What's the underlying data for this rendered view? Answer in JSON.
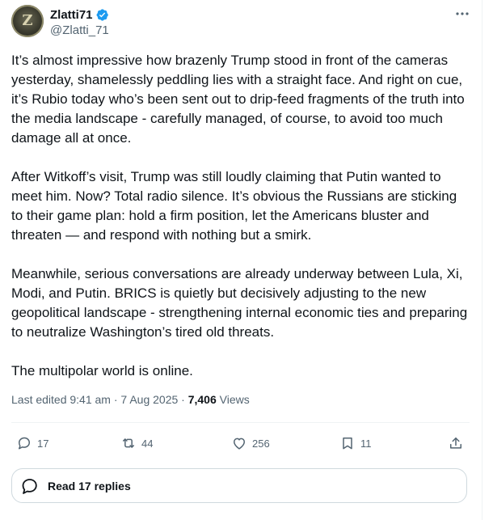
{
  "author": {
    "display_name": "Zlatti71",
    "handle": "@Zlatti_71",
    "avatar_letter": "Z",
    "verified": true
  },
  "post": {
    "paragraphs": [
      "It’s almost impressive how brazenly Trump stood in front of the cameras yesterday, shamelessly peddling lies with a straight face. And right on cue, it’s Rubio today who’s been sent out to drip-feed fragments of the truth into the media landscape - carefully managed, of course, to avoid too much damage all at once.",
      "After Witkoff’s visit, Trump was still loudly claiming that Putin wanted to meet him. Now? Total radio silence. It’s obvious the Russians are sticking to their game plan: hold a firm position, let the Americans bluster and threaten — and respond with nothing but a smirk.",
      "Meanwhile, serious conversations are already underway between Lula, Xi, Modi, and Putin. BRICS is quietly but decisively adjusting to the new geopolitical landscape - strengthening internal economic ties and preparing to neutralize Washington’s tired old threats.",
      "The multipolar world is online."
    ]
  },
  "meta": {
    "edited_label": "Last edited 9:41 am · 7 Aug 2025 · ",
    "views_count": "7,406",
    "views_label": " Views"
  },
  "actions": {
    "replies": "17",
    "reposts": "44",
    "likes": "256",
    "bookmarks": "11"
  },
  "read_replies": {
    "label": "Read 17 replies"
  },
  "icons": [
    "verified-badge-icon",
    "more-icon",
    "reply-icon",
    "repost-icon",
    "like-icon",
    "bookmark-icon",
    "share-icon",
    "chat-bubble-icon"
  ],
  "colors": {
    "text": "#0f1419",
    "secondary": "#536471",
    "verified": "#1d9bf0",
    "border": "#cfd9de",
    "divider": "#eff3f4"
  }
}
